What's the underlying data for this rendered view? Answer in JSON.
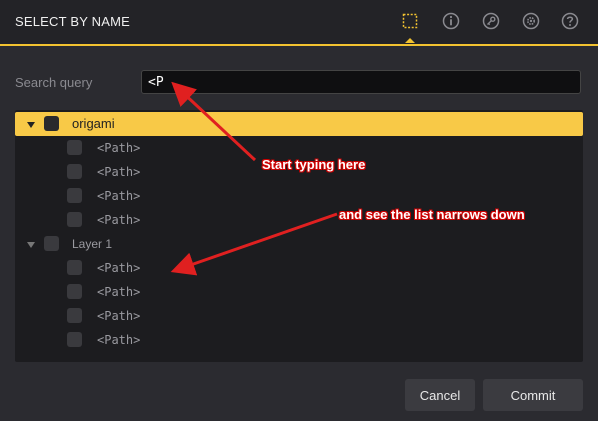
{
  "dialog": {
    "title": "SELECT BY NAME",
    "accent_color": "#f2c230",
    "header_icons": [
      "selection-box-icon",
      "info-icon",
      "key-icon",
      "gear-icon",
      "help-icon"
    ]
  },
  "search": {
    "label": "Search query",
    "value": "<P"
  },
  "tree": {
    "groups": [
      {
        "label": "origami",
        "selected": true,
        "items": [
          "<Path>",
          "<Path>",
          "<Path>",
          "<Path>"
        ]
      },
      {
        "label": "Layer 1",
        "selected": false,
        "items": [
          "<Path>",
          "<Path>",
          "<Path>",
          "<Path>"
        ]
      }
    ]
  },
  "buttons": {
    "cancel": "Cancel",
    "commit": "Commit"
  },
  "annotations": {
    "first": "Start typing here",
    "second": "and see the list narrows down",
    "color": "#e02020"
  }
}
